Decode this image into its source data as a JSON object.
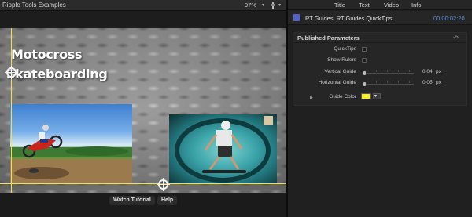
{
  "viewer": {
    "title": "Ripple Tools Examples",
    "zoom": "97%",
    "canvas": {
      "title_line1": "Motocross",
      "title_line2": "Skateboarding",
      "guide_color": "#f2e24a"
    },
    "buttons": {
      "watch_tutorial": "Watch Tutorial",
      "help": "Help"
    }
  },
  "inspector": {
    "tabs": [
      "Title",
      "Text",
      "Video",
      "Info"
    ],
    "effect_name": "RT Guides: RT Guides QuickTips",
    "timecode": "00:00:02:20",
    "section_title": "Published Parameters",
    "params": {
      "quicktips_label": "QuickTips",
      "show_rulers_label": "Show Rulers",
      "vertical_guide_label": "Vertical Guide",
      "vertical_guide_value": "0.04",
      "vertical_guide_unit": "px",
      "horizontal_guide_label": "Horizontal Guide",
      "horizontal_guide_value": "0.05",
      "horizontal_guide_unit": "px",
      "guide_color_label": "Guide Color",
      "guide_color_value": "#f6ec33"
    }
  }
}
